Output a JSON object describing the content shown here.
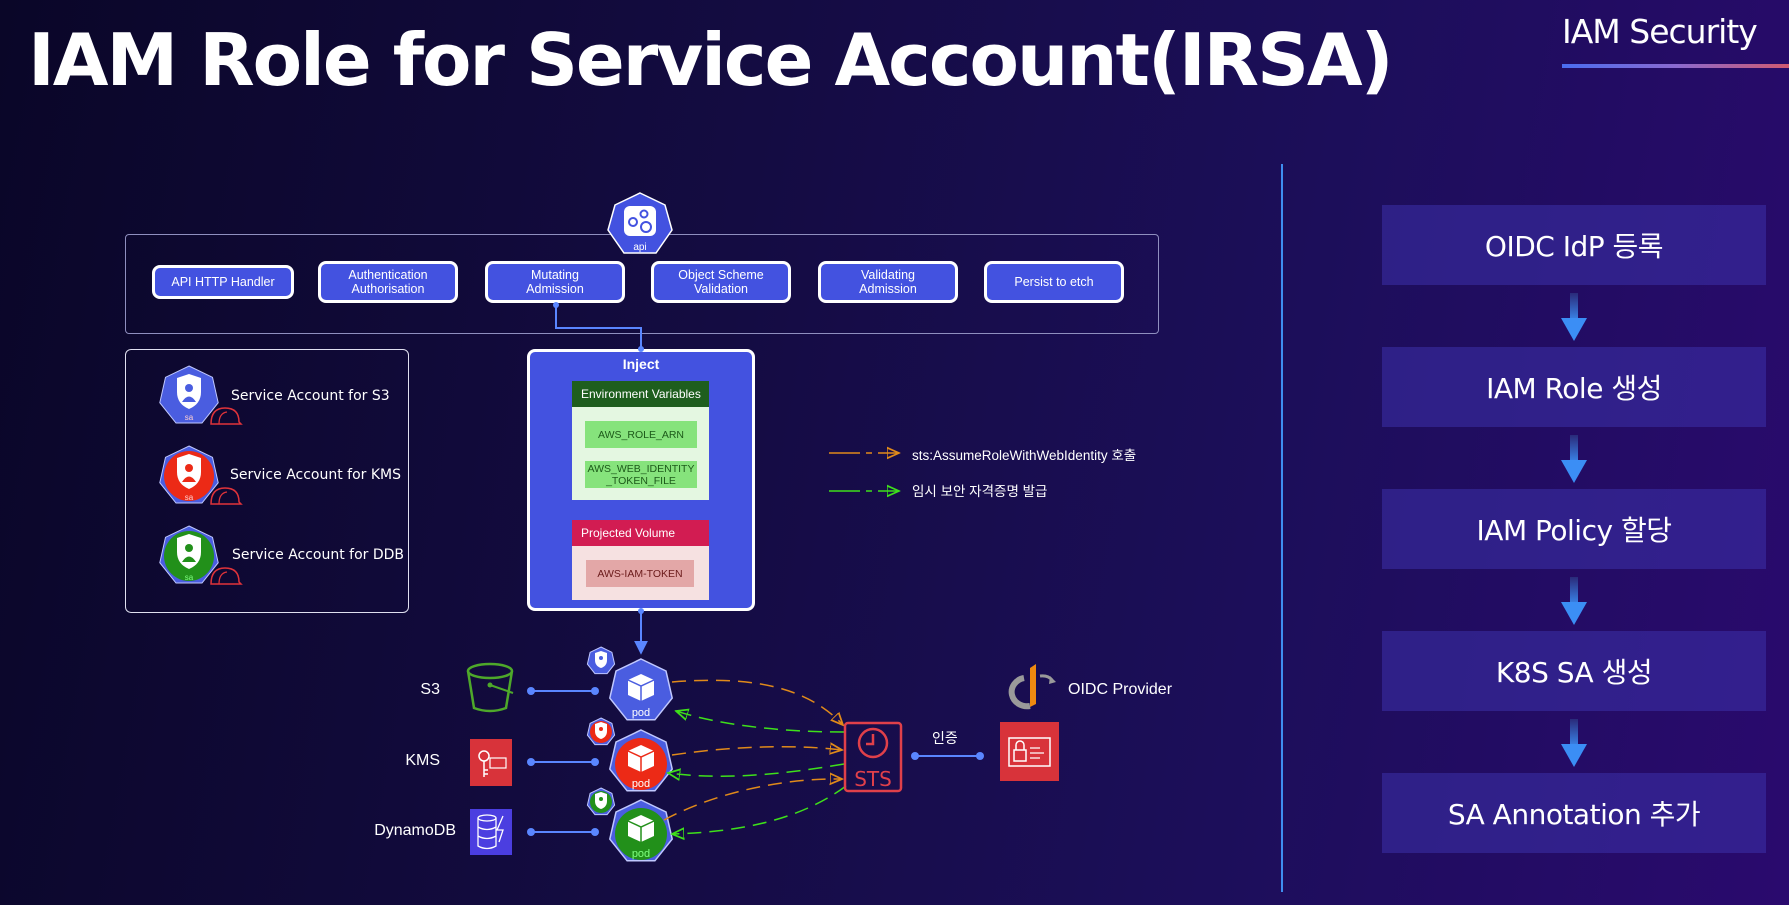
{
  "header": {
    "title": "IAM Role for Service Account(IRSA)",
    "section": "IAM Security"
  },
  "api_server": {
    "icon_label": "api",
    "stages": [
      "API  HTTP Handler",
      "Authentication\nAuthorisation",
      "Mutating\nAdmission",
      "Object Scheme\nValidation",
      "Validating\nAdmission",
      "Persist to etch"
    ]
  },
  "service_accounts": [
    {
      "label": "Service Account for S3",
      "icon_label": "sa",
      "color": "#4a5de0"
    },
    {
      "label": "Service Account for KMS",
      "icon_label": "sa",
      "color": "#ec2a16"
    },
    {
      "label": "Service Account for DDB",
      "icon_label": "sa",
      "color": "#22901a"
    }
  ],
  "inject": {
    "title": "Inject",
    "env": {
      "header": "Environment Variables",
      "items": [
        "AWS_ROLE_ARN",
        "AWS_WEB_IDENTITY\n_TOKEN_FILE"
      ]
    },
    "volume": {
      "header": "Projected Volume",
      "items": [
        "AWS-IAM-TOKEN"
      ]
    }
  },
  "legend": [
    {
      "label": "sts:AssumeRoleWithWebIdentity 호출",
      "color": "#e08a1a"
    },
    {
      "label": "임시 보안 자격증명 발급",
      "color": "#3ee01a"
    }
  ],
  "services": [
    {
      "label": "S3",
      "pod_label": "pod",
      "color": "#4a5de0"
    },
    {
      "label": "KMS",
      "pod_label": "pod",
      "color": "#ec2a16"
    },
    {
      "label": "DynamoDB",
      "pod_label": "pod",
      "color": "#22901a"
    }
  ],
  "sts": {
    "label": "STS",
    "auth_label": "인증"
  },
  "oidc": {
    "label": "OIDC Provider"
  },
  "flow_steps": [
    "OIDC IdP 등록",
    "IAM Role 생성",
    "IAM Policy 할당",
    "K8S SA 생성",
    "SA Annotation 추가"
  ]
}
